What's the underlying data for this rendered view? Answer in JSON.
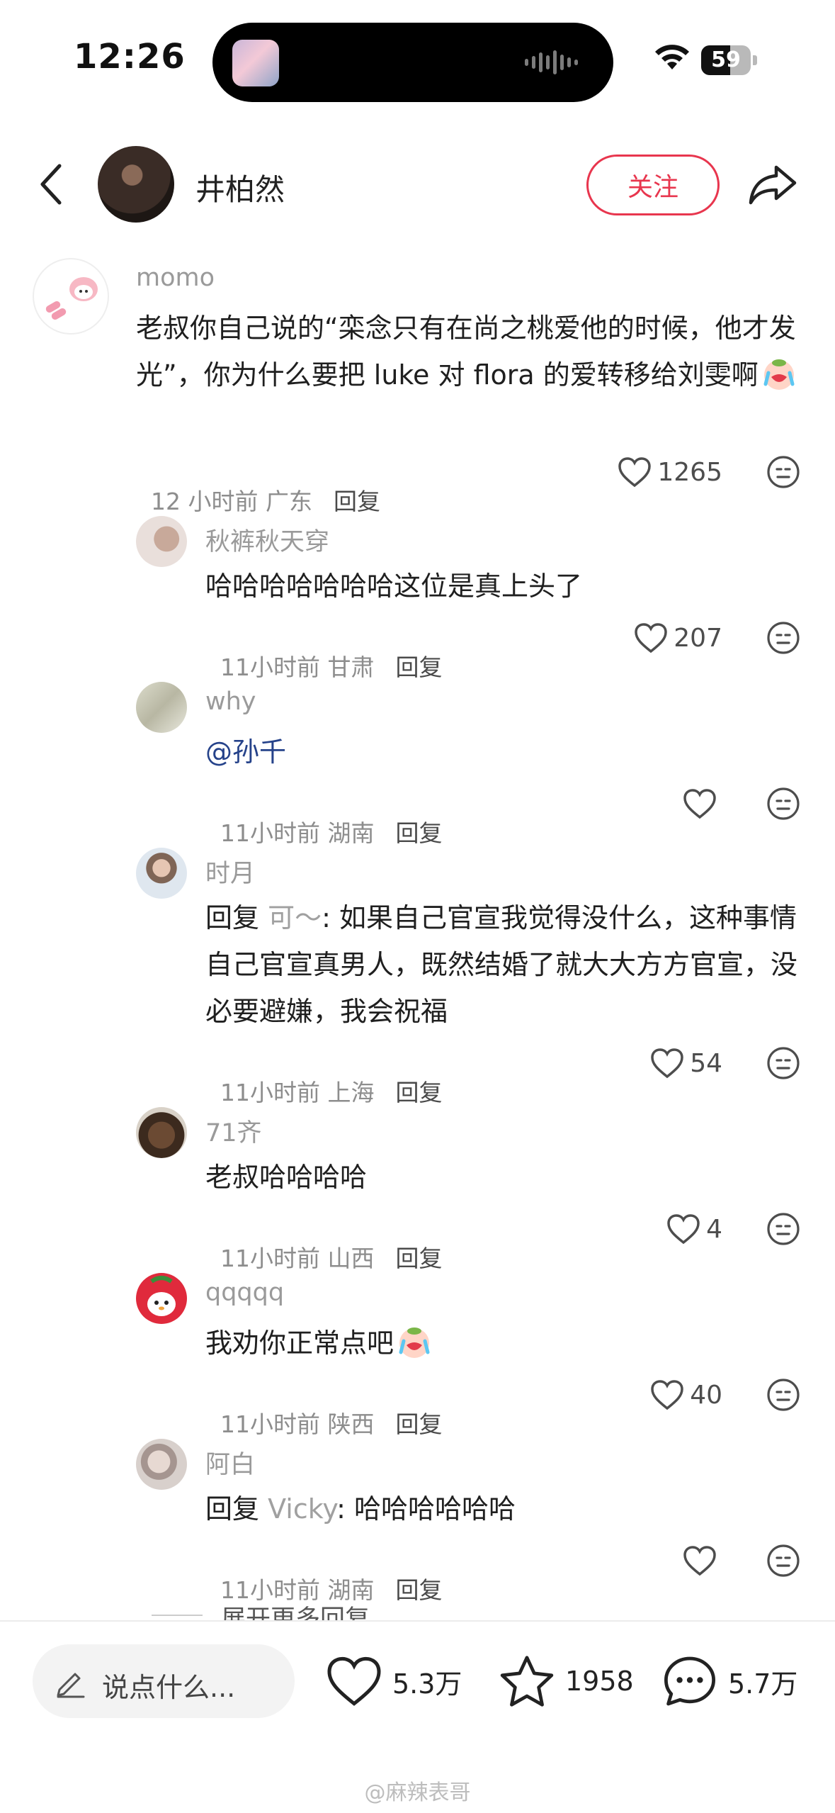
{
  "status_bar": {
    "time": "12:26",
    "battery": "59",
    "battery_level": 0.59
  },
  "header": {
    "author_name": "井柏然",
    "follow_label": "关注"
  },
  "comments": [
    {
      "user": "momo",
      "text": "老叔你自己说的“栾念只有在尚之桃爱他的时候，他才发光”，你为什么要把 luke 对 flora 的爱转移给刘雯啊",
      "time": "12 小时前",
      "location": "广东",
      "reply_label": "回复",
      "likes": "1265"
    },
    {
      "user": "秋裤秋天穿",
      "text": "哈哈哈哈哈哈哈这位是真上头了",
      "time": "11小时前",
      "location": "甘肃",
      "reply_label": "回复",
      "likes": "207"
    },
    {
      "user": "why",
      "text": "@孙千",
      "time": "11小时前",
      "location": "湖南",
      "reply_label": "回复",
      "likes": ""
    },
    {
      "user": "时月",
      "reply_prefix": "回复",
      "reply_to": "可～",
      "text": ": 如果自己官宣我觉得没什么，这种事情自己官宣真男人，既然结婚了就大大方方官宣，没必要避嫌，我会祝福",
      "time": "11小时前",
      "location": "上海",
      "reply_label": "回复",
      "likes": "54"
    },
    {
      "user": "71齐",
      "text": "老叔哈哈哈哈",
      "time": "11小时前",
      "location": "山西",
      "reply_label": "回复",
      "likes": "4"
    },
    {
      "user": "qqqqq",
      "text": "我劝你正常点吧",
      "time": "11小时前",
      "location": "陕西",
      "reply_label": "回复",
      "likes": "40"
    },
    {
      "user": "阿白",
      "reply_prefix": "回复",
      "reply_to": "Vicky",
      "text": ": 哈哈哈哈哈哈",
      "time": "11小时前",
      "location": "湖南",
      "reply_label": "回复",
      "likes": ""
    }
  ],
  "expand_replies": "展开更多回复",
  "bottom_bar": {
    "input_placeholder": "说点什么...",
    "likes": "5.3万",
    "collects": "1958",
    "comments": "5.7万"
  },
  "watermark": "@麻辣表哥",
  "colors": {
    "accent": "#e8364e",
    "mention": "#25428a"
  },
  "icons": [
    "back-icon",
    "share-icon",
    "heart-icon",
    "face-icon",
    "star-icon",
    "comment-bubble-icon",
    "pencil-icon",
    "wifi-icon",
    "battery-icon"
  ]
}
